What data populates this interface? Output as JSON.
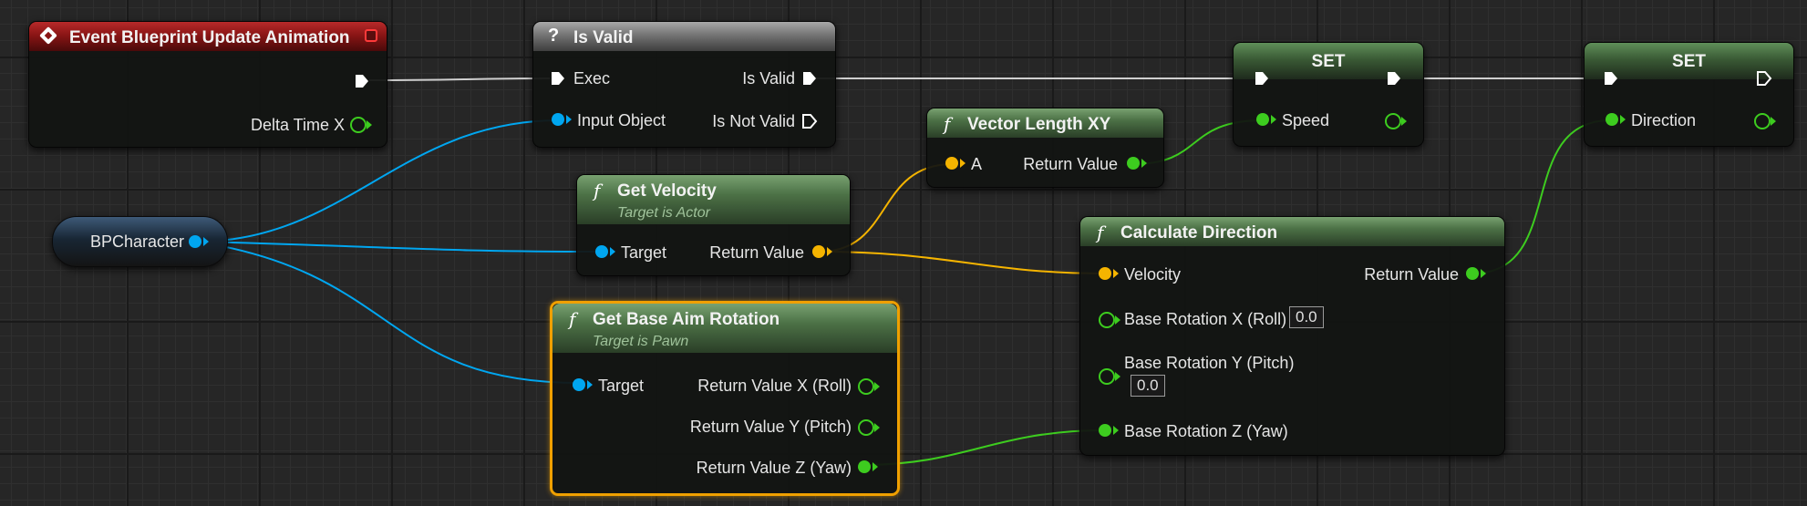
{
  "graph": {
    "event_node": {
      "title": "Event Blueprint Update Animation",
      "pin_delta": "Delta Time X"
    },
    "is_valid_node": {
      "title": "Is Valid",
      "pin_exec": "Exec",
      "pin_input_object": "Input Object",
      "pin_is_valid": "Is Valid",
      "pin_is_not_valid": "Is Not Valid"
    },
    "variable_node": {
      "label": "BPCharacter"
    },
    "get_velocity_node": {
      "title": "Get Velocity",
      "subtitle": "Target is Actor",
      "pin_target": "Target",
      "pin_return": "Return Value"
    },
    "get_base_aim_node": {
      "title": "Get Base Aim Rotation",
      "subtitle": "Target is Pawn",
      "pin_target": "Target",
      "pin_return_x": "Return Value X (Roll)",
      "pin_return_y": "Return Value Y (Pitch)",
      "pin_return_z": "Return Value Z (Yaw)"
    },
    "vector_length_node": {
      "title": "Vector Length XY",
      "pin_a": "A",
      "pin_return": "Return Value"
    },
    "calc_direction_node": {
      "title": "Calculate Direction",
      "pin_velocity": "Velocity",
      "pin_return": "Return Value",
      "pin_roll": "Base Rotation X (Roll)",
      "roll_value": "0.0",
      "pin_pitch": "Base Rotation Y (Pitch)",
      "pitch_value": "0.0",
      "pin_yaw": "Base Rotation Z (Yaw)"
    },
    "set_speed_node": {
      "title": "SET",
      "pin_var": "Speed"
    },
    "set_direction_node": {
      "title": "SET",
      "pin_var": "Direction"
    },
    "func_glyph": "f"
  },
  "colors": {
    "object_pin": "#00a6f0",
    "vector_pin": "#f5b400",
    "float_pin": "#3dcc1f",
    "exec_wire": "#d8d8d8",
    "selection": "#f0a000",
    "event_header": "#8a1515",
    "function_header": "#4c7146"
  }
}
